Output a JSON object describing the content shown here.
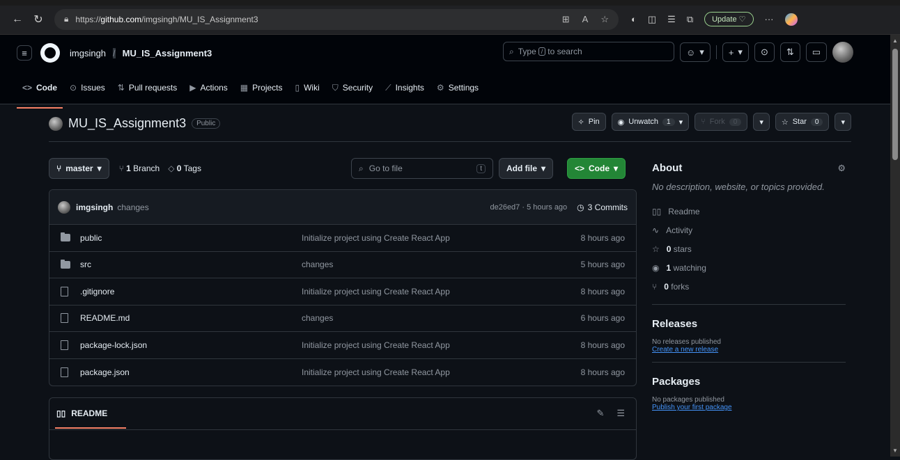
{
  "browser": {
    "url_prefix": "https://",
    "url_host": "github.com",
    "url_path": "/imgsingh/MU_IS_Assignment3",
    "update_label": "Update",
    "more_label": "···"
  },
  "header": {
    "owner": "imgsingh",
    "separator": "/",
    "repo": "MU_IS_Assignment3",
    "search_prefix": "Type",
    "search_key": "/",
    "search_suffix": "to search"
  },
  "nav": [
    {
      "icon": "<>",
      "label": "Code"
    },
    {
      "icon": "⊙",
      "label": "Issues"
    },
    {
      "icon": "⇅",
      "label": "Pull requests"
    },
    {
      "icon": "▶",
      "label": "Actions"
    },
    {
      "icon": "▦",
      "label": "Projects"
    },
    {
      "icon": "▯",
      "label": "Wiki"
    },
    {
      "icon": "⛉",
      "label": "Security"
    },
    {
      "icon": "⟋",
      "label": "Insights"
    },
    {
      "icon": "⚙",
      "label": "Settings"
    }
  ],
  "repo": {
    "name": "MU_IS_Assignment3",
    "visibility": "Public",
    "pin_label": "Pin",
    "unwatch_label": "Unwatch",
    "watch_count": "1",
    "fork_label": "Fork",
    "fork_count": "0",
    "star_label": "Star",
    "star_count": "0"
  },
  "toolbar": {
    "branch": "master",
    "branch_count": "1",
    "branch_word": "Branch",
    "tag_count": "0",
    "tag_word": "Tags",
    "goto_placeholder": "Go to file",
    "goto_key": "t",
    "add_file": "Add file",
    "code": "Code"
  },
  "commit": {
    "author": "imgsingh",
    "message": "changes",
    "hash_time": "de26ed7 · 5 hours ago",
    "commits": "3 Commits"
  },
  "files": [
    {
      "type": "folder",
      "name": "public",
      "message": "Initialize project using Create React App",
      "time": "8 hours ago"
    },
    {
      "type": "folder",
      "name": "src",
      "message": "changes",
      "time": "5 hours ago"
    },
    {
      "type": "file",
      "name": ".gitignore",
      "message": "Initialize project using Create React App",
      "time": "8 hours ago"
    },
    {
      "type": "file",
      "name": "README.md",
      "message": "changes",
      "time": "6 hours ago"
    },
    {
      "type": "file",
      "name": "package-lock.json",
      "message": "Initialize project using Create React App",
      "time": "8 hours ago"
    },
    {
      "type": "file",
      "name": "package.json",
      "message": "Initialize project using Create React App",
      "time": "8 hours ago"
    }
  ],
  "readme": {
    "title": "README"
  },
  "about": {
    "title": "About",
    "description": "No description, website, or topics provided.",
    "readme": "Readme",
    "activity": "Activity",
    "stars_count": "0",
    "stars_word": "stars",
    "watching_count": "1",
    "watching_word": "watching",
    "forks_count": "0",
    "forks_word": "forks"
  },
  "releases": {
    "title": "Releases",
    "none": "No releases published",
    "link": "Create a new release"
  },
  "packages": {
    "title": "Packages",
    "none": "No packages published",
    "link": "Publish your first package"
  }
}
